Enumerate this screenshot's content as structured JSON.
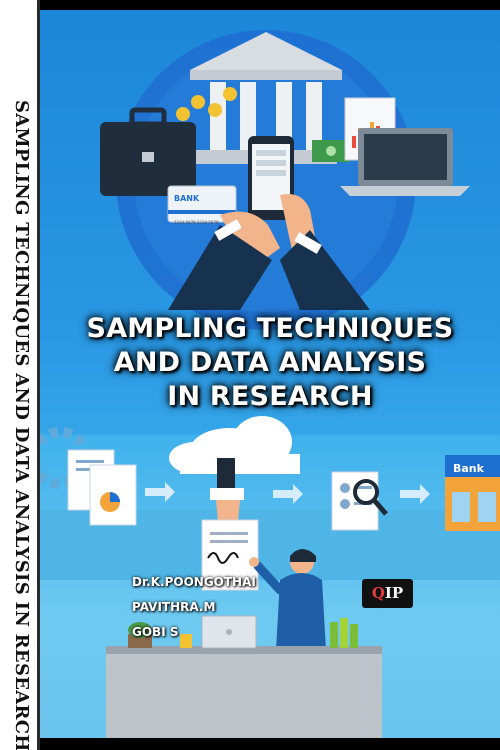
{
  "spine": {
    "title": "SAMPLING TECHNIQUES AND DATA ANALYSIS IN RESEARCH"
  },
  "cover": {
    "title_lines": [
      "SAMPLING TECHNIQUES",
      "AND DATA ANALYSIS",
      "IN RESEARCH"
    ],
    "authors": [
      "Dr.K.POONGOTHAI",
      "PAVITHRA.M",
      "GOBI S"
    ],
    "publisher_logo": {
      "q": "Q",
      "rest": "IP"
    },
    "bank_card_label": "BANK",
    "bank_card_number": "1234 5678 1234 5678",
    "bank_building_label": "Bank"
  },
  "colors": {
    "sky": "#2a98e4",
    "title": "#ffffff",
    "spine": "#ffffff"
  }
}
